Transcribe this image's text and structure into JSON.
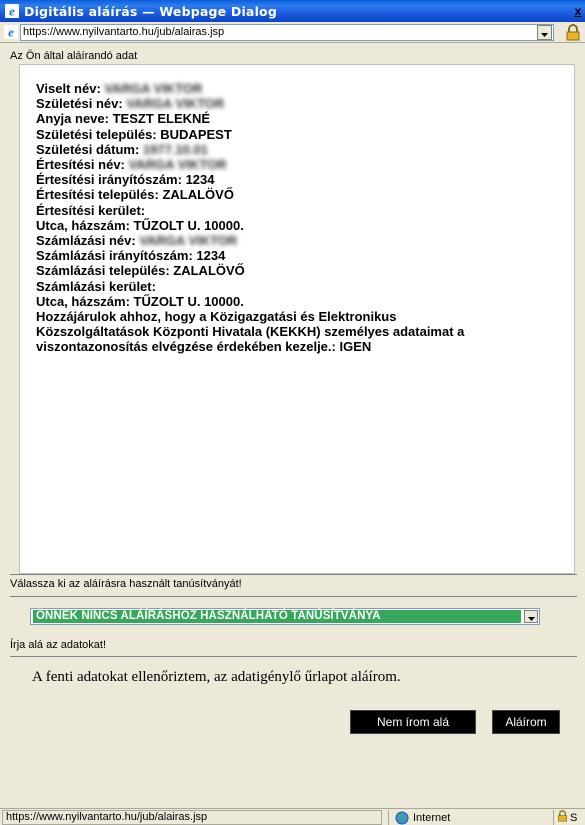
{
  "window": {
    "title": "Digitális aláírás — Webpage Dialog",
    "close_label": "x"
  },
  "address": {
    "url": "https://www.nyilvantarto.hu/jub/alairas.jsp"
  },
  "data_section": {
    "heading": "Az Ön által aláírandó adat",
    "lines": [
      {
        "label": "Viselt név: ",
        "value": "VARGA VIKTOR",
        "redacted": true
      },
      {
        "label": "Születési név: ",
        "value": "VARGA VIKTOR",
        "redacted": true
      },
      {
        "label": "Anyja neve: ",
        "value": "TESZT ELEKNÉ",
        "redacted": false
      },
      {
        "label": "Születési település: ",
        "value": "BUDAPEST",
        "redacted": false
      },
      {
        "label": "Születési dátum: ",
        "value": "1977.10.01",
        "redacted": true
      },
      {
        "label": "Értesítési név: ",
        "value": "VARGA VIKTOR",
        "redacted": true
      },
      {
        "label": "Értesítési irányítószám: ",
        "value": "1234",
        "redacted": false
      },
      {
        "label": "Értesítési település: ",
        "value": "ZALALÖVŐ",
        "redacted": false
      },
      {
        "label": "Értesítési kerület:",
        "value": "",
        "redacted": false
      },
      {
        "label": "Utca, házszám: ",
        "value": "TŰZOLT U. 10000.",
        "redacted": false
      },
      {
        "label": "Számlázási név: ",
        "value": "VARGA VIKTOR",
        "redacted": true
      },
      {
        "label": "Számlázási irányítószám: ",
        "value": "1234",
        "redacted": false
      },
      {
        "label": "Számlázási település: ",
        "value": "ZALALÖVŐ",
        "redacted": false
      },
      {
        "label": "Számlázási kerület:",
        "value": "",
        "redacted": false
      },
      {
        "label": "Utca, házszám: ",
        "value": "TŰZOLT U. 10000.",
        "redacted": false
      },
      {
        "label": "Hozzájárulok ahhoz, hogy a Közigazgatási és Elektronikus",
        "value": "",
        "redacted": false
      },
      {
        "label": "Közszolgáltatások Központi Hivatala (KEKKH) személyes adataimat a",
        "value": "",
        "redacted": false
      },
      {
        "label": "viszontazonosítás elvégzése érdekében kezelje.: ",
        "value": "IGEN",
        "redacted": false
      }
    ]
  },
  "certificate": {
    "heading": "Válassza ki az aláírásra használt tanúsítványát!",
    "selected": "ÖNNEK NINCS ALÁÍRÁSHOZ HASZNÁLHATÓ TANÚSÍTVÁNYA"
  },
  "sign": {
    "heading": "Írja alá az adatokat!",
    "confirm_text": "A fenti adatokat ellenőriztem, az adatigénylő űrlapot aláírom.",
    "decline_label": "Nem írom alá",
    "accept_label": "Aláírom"
  },
  "status": {
    "url": "https://www.nyilvantarto.hu/jub/alairas.jsp",
    "zone": "Internet",
    "ssl_text": "S"
  },
  "colors": {
    "titlebar": "#0d44c4",
    "selection": "#35a85a",
    "button_bg": "#000000"
  }
}
